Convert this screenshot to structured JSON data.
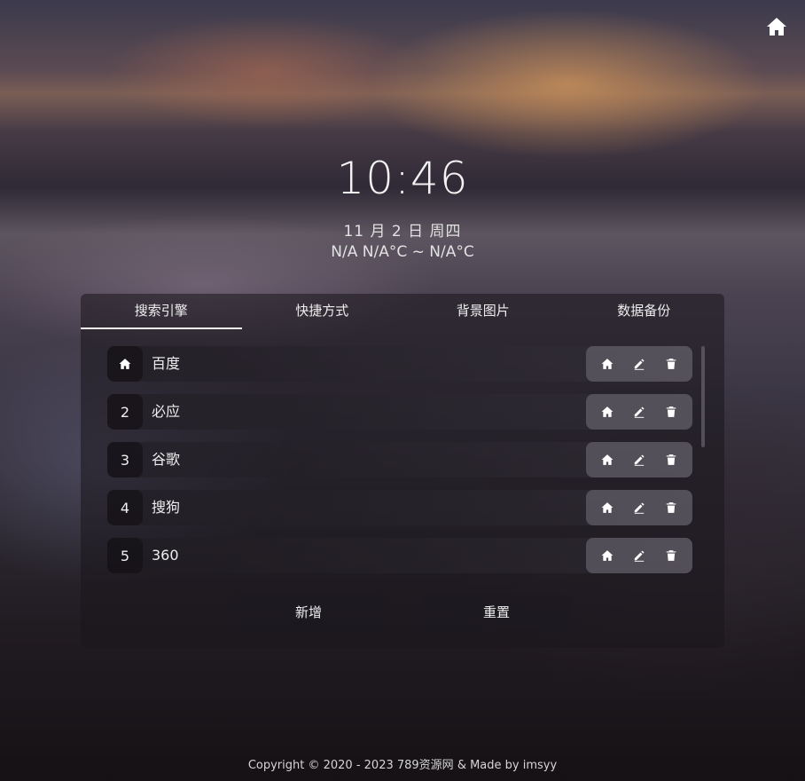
{
  "time": "10:46",
  "date": "11 月 2 日 周四",
  "weather": "N/A N/A°C ~ N/A°C",
  "tabs": [
    {
      "label": "搜索引擎",
      "active": true
    },
    {
      "label": "快捷方式",
      "active": false
    },
    {
      "label": "背景图片",
      "active": false
    },
    {
      "label": "数据备份",
      "active": false
    }
  ],
  "engines": [
    {
      "index": "",
      "index_icon": "home-icon",
      "name": "百度"
    },
    {
      "index": "2",
      "name": "必应"
    },
    {
      "index": "3",
      "name": "谷歌"
    },
    {
      "index": "4",
      "name": "搜狗"
    },
    {
      "index": "5",
      "name": "360"
    }
  ],
  "row_action_icons": [
    "home-icon",
    "edit-icon",
    "trash-icon"
  ],
  "buttons": {
    "add_label": "新增",
    "reset_label": "重置"
  },
  "footer": "Copyright © 2020 - 2023 789资源网 &  Made by imsyy"
}
